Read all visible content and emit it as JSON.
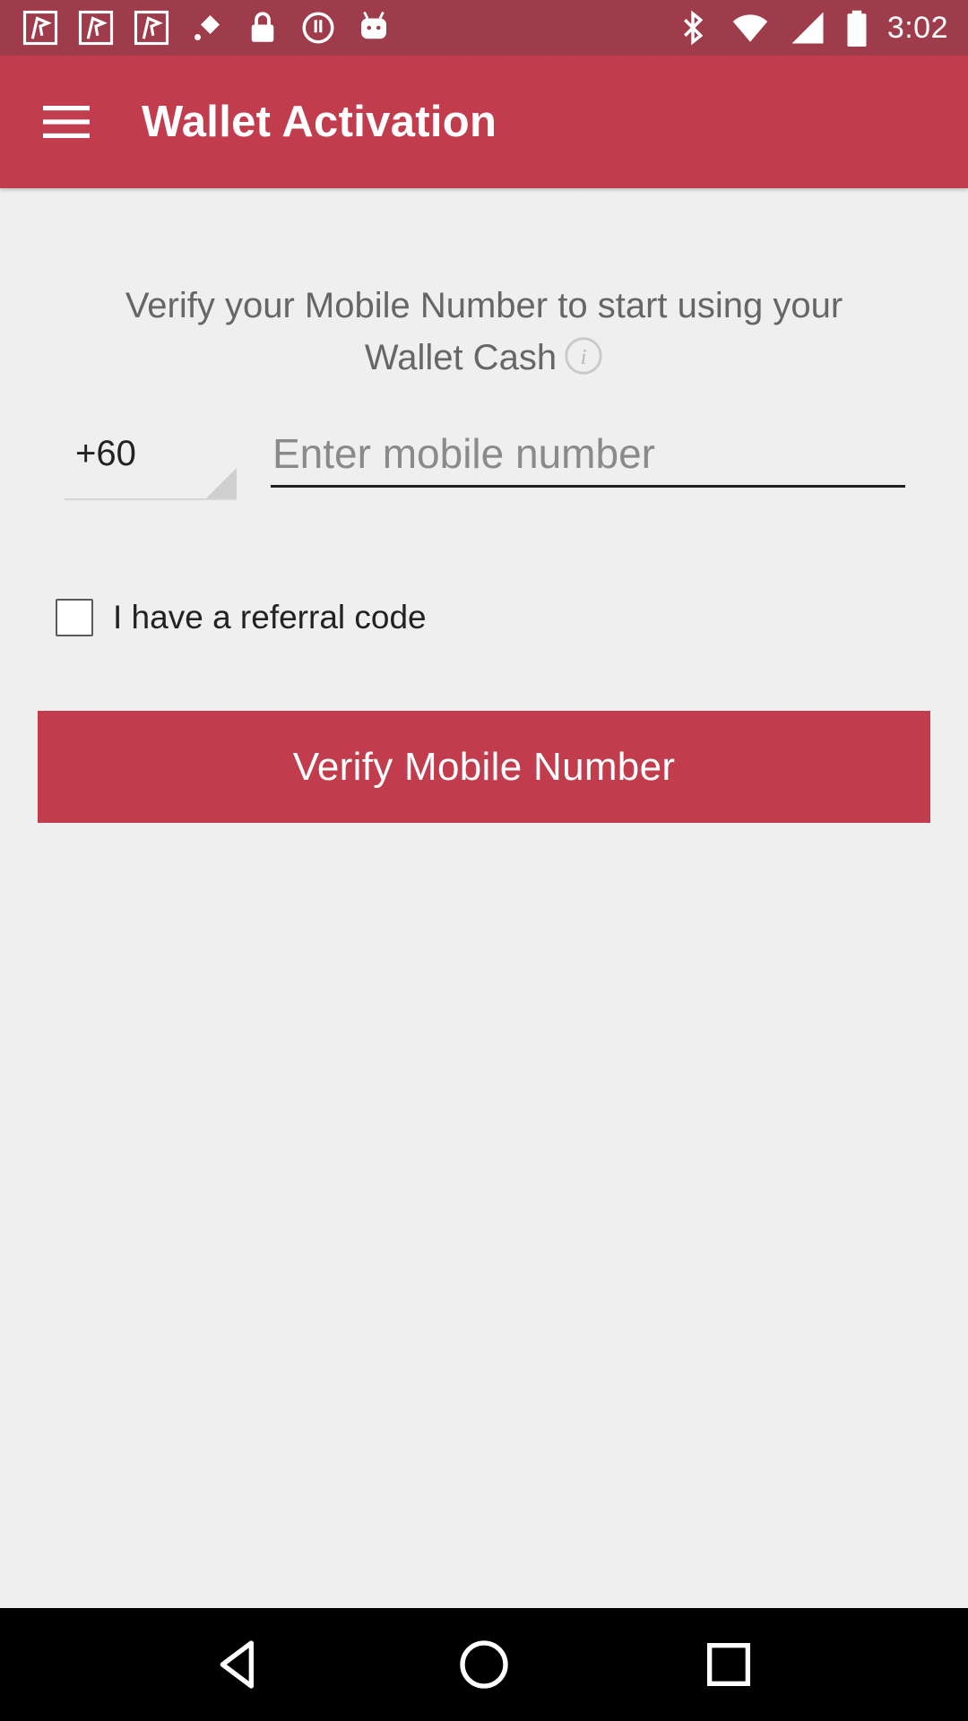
{
  "status_bar": {
    "time": "3:02",
    "left_icons": [
      "maps-icon",
      "maps-icon",
      "maps-icon",
      "fake-gps-icon",
      "lock-icon",
      "alert-icon",
      "android-icon"
    ],
    "right_icons": [
      "bluetooth-icon",
      "wifi-icon",
      "signal-icon",
      "battery-icon"
    ]
  },
  "app_bar": {
    "title": "Wallet Activation",
    "menu_icon": "menu-icon"
  },
  "intro": {
    "line1": "Verify your Mobile Number to start using your",
    "line2": "Wallet Cash"
  },
  "phone": {
    "country_code": "+60",
    "placeholder": "Enter mobile number",
    "value": ""
  },
  "referral": {
    "label": "I have a referral code",
    "checked": false
  },
  "verify_button": {
    "label": "Verify Mobile Number"
  },
  "colors": {
    "primary": "#c13c4c",
    "status_bar": "#9e3c4b",
    "background": "#efefef"
  }
}
